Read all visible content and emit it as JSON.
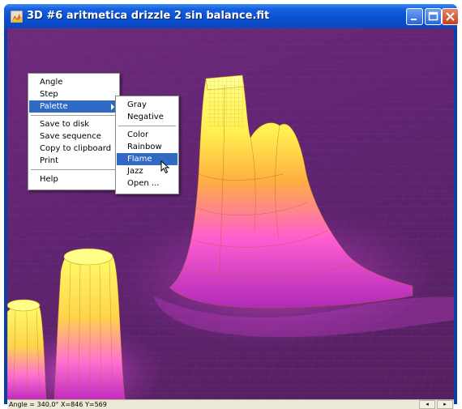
{
  "window": {
    "title": "3D #6 aritmetica drizzle 2 sin balance.fit",
    "minimize_icon": "minimize-icon",
    "maximize_icon": "maximize-icon",
    "close_icon": "close-icon",
    "app_icon": "app-icon"
  },
  "plot": {
    "description_colors": {
      "background": "#5f2470",
      "low": "#c02bc0",
      "mid": "#ff6fd0",
      "high": "#ffff60"
    }
  },
  "context_menu": {
    "items": [
      {
        "label": "Angle"
      },
      {
        "label": "Step"
      },
      {
        "label": "Palette",
        "has_submenu": true,
        "selected": true
      },
      {
        "label": "Save to disk"
      },
      {
        "label": "Save sequence"
      },
      {
        "label": "Copy to clipboard"
      },
      {
        "label": "Print"
      },
      {
        "label": "Help"
      }
    ]
  },
  "palette_submenu": {
    "items": [
      {
        "label": "Gray"
      },
      {
        "label": "Negative"
      },
      {
        "label": "Color"
      },
      {
        "label": "Rainbow"
      },
      {
        "label": "Flame",
        "selected": true
      },
      {
        "label": "Jazz"
      },
      {
        "label": "Open ..."
      }
    ]
  },
  "status": {
    "text": "Angle = 340.0° X=846 Y=569",
    "scroll_left": "◂",
    "scroll_right": "▸"
  }
}
